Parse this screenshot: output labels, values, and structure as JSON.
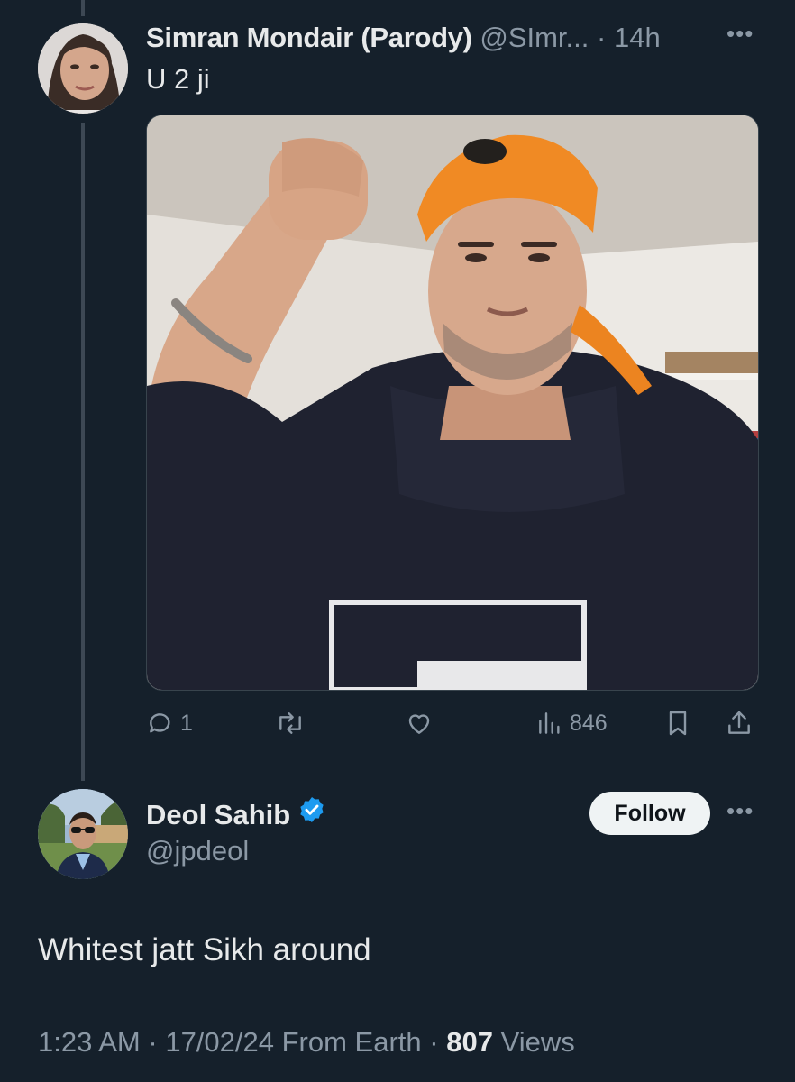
{
  "parent_tweet": {
    "display_name": "Simran Mondair (Parody)",
    "handle": "@SImr...",
    "separator": "·",
    "time": "14h",
    "text": "U 2 ji",
    "more_icon": "ellipsis-icon",
    "actions": {
      "reply_count": "1",
      "retweet_count": "",
      "like_count": "",
      "views_count": "846"
    }
  },
  "reply_tweet": {
    "display_name": "Deol Sahib",
    "verified": true,
    "handle": "@jpdeol",
    "follow_label": "Follow",
    "text": "Whitest jatt Sikh around",
    "meta": {
      "time": "1:23 AM",
      "separator": "·",
      "date": "17/02/24",
      "source": "From Earth",
      "views_count": "807",
      "views_label": "Views"
    }
  },
  "colors": {
    "background": "#15202b",
    "text_primary": "#e7e9ea",
    "text_secondary": "#8b98a5",
    "verified_blue": "#1d9bf0",
    "follow_bg": "#eff3f4"
  }
}
